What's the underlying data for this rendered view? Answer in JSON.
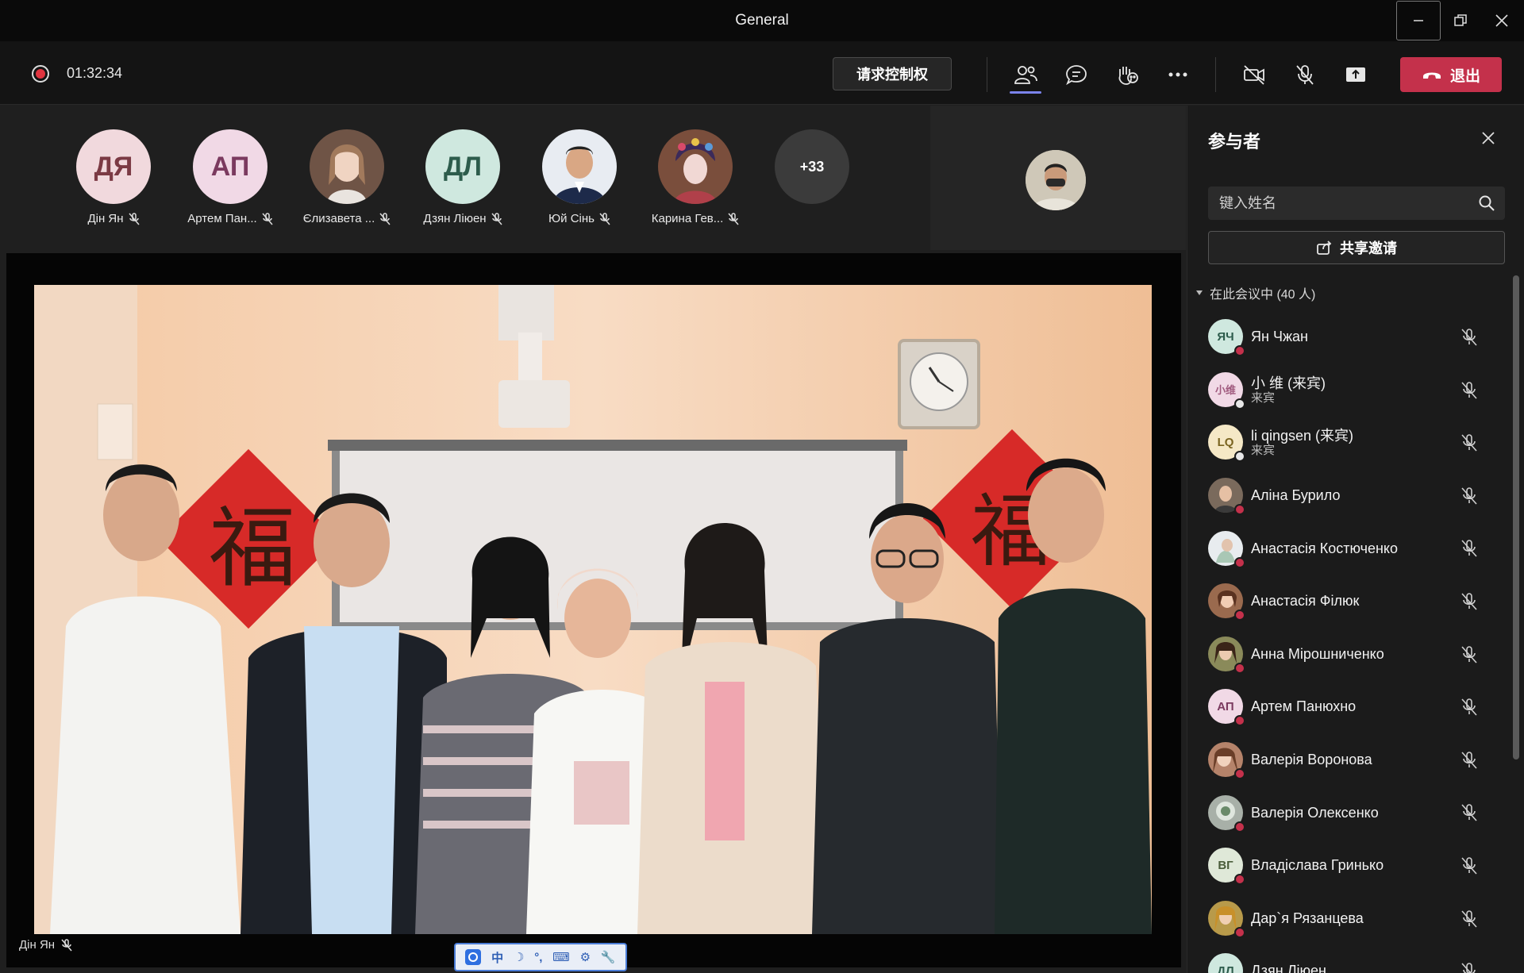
{
  "window": {
    "title": "General"
  },
  "toolbar": {
    "timer": "01:32:34",
    "request_control_label": "请求控制权",
    "leave_label": "退出"
  },
  "strip": {
    "participants": [
      {
        "initials": "ДЯ",
        "name": "Дін Ян",
        "bg": "#f1d9dd",
        "fg": "#7b3a44"
      },
      {
        "initials": "АП",
        "name": "Артем Пан...",
        "bg": "#f1d9e6",
        "fg": "#7b3a5f"
      },
      {
        "initials": "",
        "name": "Єлизавета ...",
        "bg": "#8c6b5a",
        "fg": "#fff"
      },
      {
        "initials": "ДЛ",
        "name": "Дзян Ліюен",
        "bg": "#cfe8df",
        "fg": "#2d5c4c"
      },
      {
        "initials": "",
        "name": "Юй Сінь",
        "bg": "#d9dde6",
        "fg": "#fff"
      },
      {
        "initials": "",
        "name": "Карина Гев...",
        "bg": "#8f5a48",
        "fg": "#fff"
      }
    ],
    "more_count": "+33"
  },
  "stage": {
    "speaker_name": "Дін Ян"
  },
  "ime": {
    "chars": [
      "中",
      "☽",
      "°,",
      "⌨",
      "⚙",
      "🔧"
    ]
  },
  "panel": {
    "title": "参与者",
    "search_placeholder": "键入姓名",
    "share_label": "共享邀请",
    "section_label": "在此会议中 (40 人)",
    "people": [
      {
        "initials": "ЯЧ",
        "name": "Ян Чжан",
        "sub": "",
        "bg": "#cfe8df",
        "fg": "#2d5c4c",
        "status": "#c4314b",
        "photo": false
      },
      {
        "initials": "小维",
        "name": "小 维 (来宾)",
        "sub": "来宾",
        "bg": "#f1d9e6",
        "fg": "#a05a7e",
        "status": "#e8e8e8",
        "photo": false
      },
      {
        "initials": "LQ",
        "name": "li qingsen (来宾)",
        "sub": "来宾",
        "bg": "#f5e8c6",
        "fg": "#7a6420",
        "status": "#e8e8e8",
        "photo": false
      },
      {
        "initials": "",
        "name": "Аліна Бурило",
        "sub": "",
        "bg": "#7a6a5c",
        "fg": "#fff",
        "status": "#c4314b",
        "photo": true
      },
      {
        "initials": "",
        "name": "Анастасія Костюченко",
        "sub": "",
        "bg": "#d8dcdf",
        "fg": "#fff",
        "status": "#c4314b",
        "photo": true
      },
      {
        "initials": "",
        "name": "Анастасія Філюк",
        "sub": "",
        "bg": "#9a6a4e",
        "fg": "#fff",
        "status": "#c4314b",
        "photo": true
      },
      {
        "initials": "",
        "name": "Анна Мірошниченко",
        "sub": "",
        "bg": "#8a8a5a",
        "fg": "#fff",
        "status": "#c4314b",
        "photo": true
      },
      {
        "initials": "АП",
        "name": "Артем Панюхно",
        "sub": "",
        "bg": "#f1d9e6",
        "fg": "#7b3a5f",
        "status": "#c4314b",
        "photo": false
      },
      {
        "initials": "",
        "name": "Валерія Воронова",
        "sub": "",
        "bg": "#b5836a",
        "fg": "#fff",
        "status": "#c4314b",
        "photo": true
      },
      {
        "initials": "",
        "name": "Валерія Олексенко",
        "sub": "",
        "bg": "#a8b0a8",
        "fg": "#fff",
        "status": "#c4314b",
        "photo": true
      },
      {
        "initials": "ВГ",
        "name": "Владіслава Гринько",
        "sub": "",
        "bg": "#dfe8d8",
        "fg": "#4a5c3a",
        "status": "#c4314b",
        "photo": false
      },
      {
        "initials": "",
        "name": "Дар`я Рязанцева",
        "sub": "",
        "bg": "#b89a4a",
        "fg": "#fff",
        "status": "#c4314b",
        "photo": true
      },
      {
        "initials": "ДЛ",
        "name": "Дзян Ліюен",
        "sub": "",
        "bg": "#cfe8df",
        "fg": "#2d5c4c",
        "status": "#c4314b",
        "photo": false
      }
    ]
  },
  "colors": {
    "accent": "#7b83eb",
    "leave": "#c4314b",
    "record": "#e0343f"
  }
}
